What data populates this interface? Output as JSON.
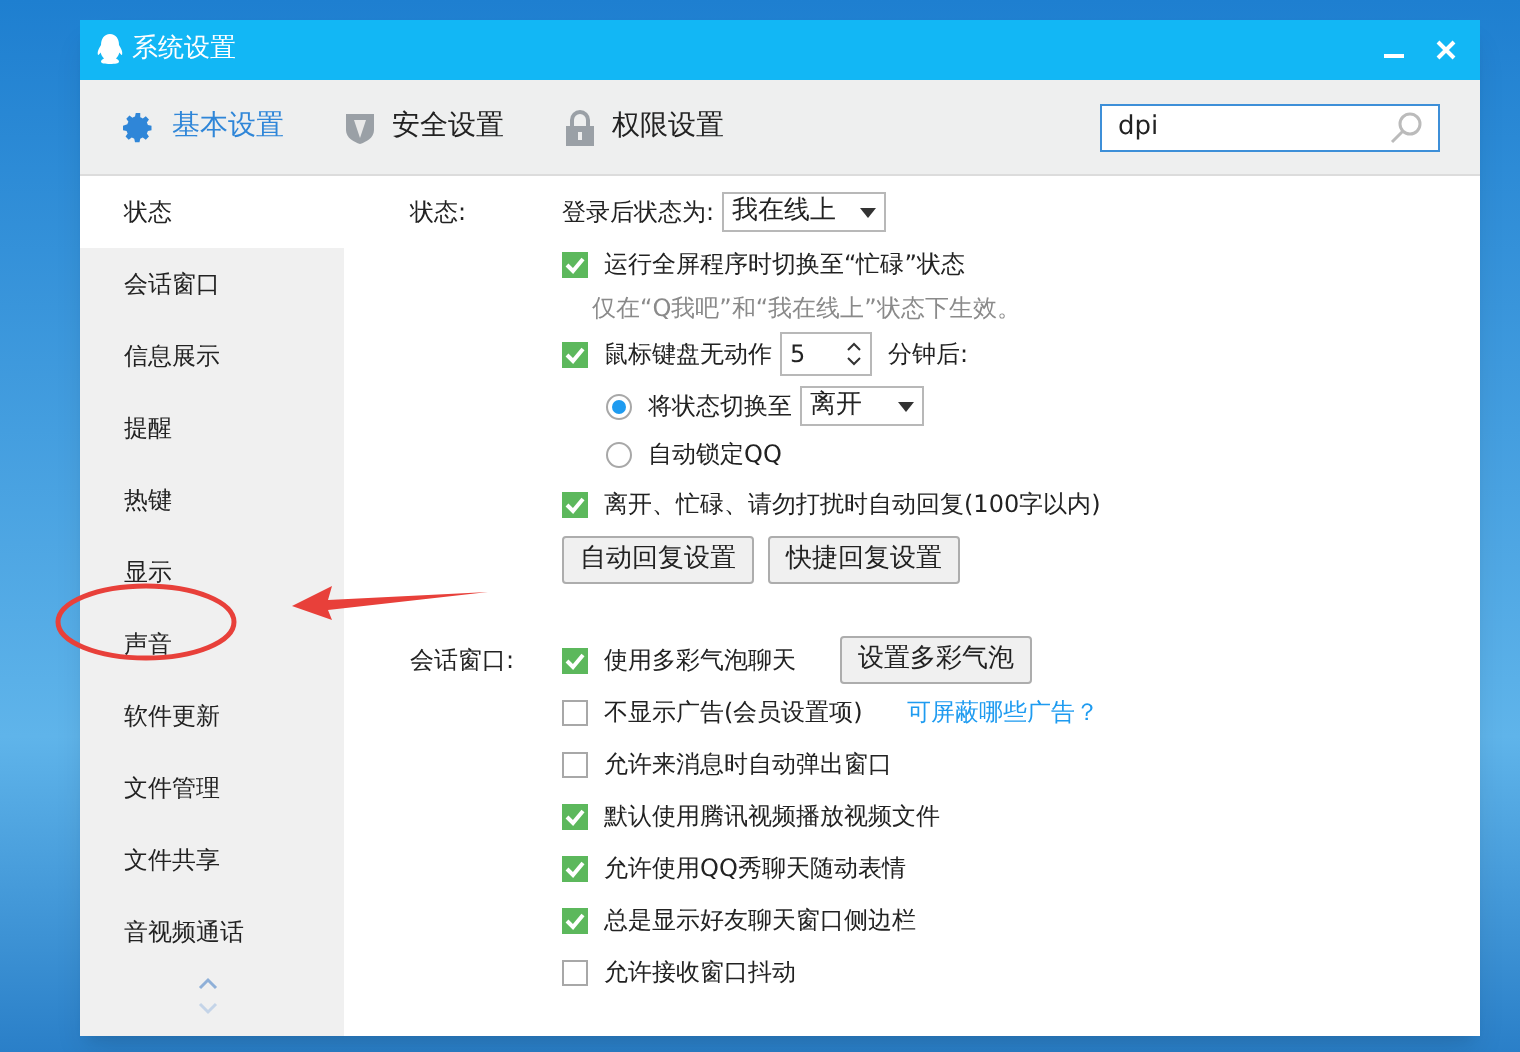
{
  "window": {
    "title": "系统设置"
  },
  "tabs": [
    {
      "label": "基本设置",
      "kind": "gear",
      "selected": true
    },
    {
      "label": "安全设置",
      "kind": "shield",
      "selected": false
    },
    {
      "label": "权限设置",
      "kind": "lock",
      "selected": false
    }
  ],
  "search": {
    "value": "dpi"
  },
  "sidebar": {
    "items": [
      {
        "label": "状态",
        "selected": true
      },
      {
        "label": "会话窗口",
        "selected": false
      },
      {
        "label": "信息展示",
        "selected": false
      },
      {
        "label": "提醒",
        "selected": false
      },
      {
        "label": "热键",
        "selected": false
      },
      {
        "label": "显示",
        "selected": false
      },
      {
        "label": "声音",
        "selected": false
      },
      {
        "label": "软件更新",
        "selected": false
      },
      {
        "label": "文件管理",
        "selected": false
      },
      {
        "label": "文件共享",
        "selected": false
      },
      {
        "label": "音视频通话",
        "selected": false
      }
    ]
  },
  "sections": [
    {
      "label": "状态:",
      "rows": [
        {
          "kind": "select",
          "label": "登录后状态为:",
          "value": "我在线上"
        },
        {
          "kind": "checkbox",
          "label": "运行全屏程序时切换至“忙碌”状态",
          "checked": true
        },
        {
          "kind": "hint",
          "label": "仅在“Q我吧”和“我在线上”状态下生效。"
        },
        {
          "kind": "spinner",
          "label": "鼠标键盘无动作",
          "value": "5",
          "suffix": "分钟后:",
          "checked": true
        },
        {
          "kind": "radio",
          "label": "将状态切换至",
          "value": "离开",
          "checked": true
        },
        {
          "kind": "radio",
          "label": "自动锁定QQ",
          "checked": false
        },
        {
          "kind": "checkbox",
          "label": "离开、忙碌、请勿打扰时自动回复(100字以内)",
          "checked": true
        },
        {
          "kind": "buttons",
          "buttons": [
            "自动回复设置",
            "快捷回复设置"
          ]
        }
      ]
    },
    {
      "label": "会话窗口:",
      "rows": [
        {
          "kind": "checkbox",
          "label": "使用多彩气泡聊天",
          "checked": true,
          "button": "设置多彩气泡"
        },
        {
          "kind": "checkbox",
          "label": "不显示广告(会员设置项)",
          "checked": false,
          "link": "可屏蔽哪些广告？"
        },
        {
          "kind": "checkbox",
          "label": "允许来消息时自动弹出窗口",
          "checked": false
        },
        {
          "kind": "checkbox",
          "label": "默认使用腾讯视频播放视频文件",
          "checked": true
        },
        {
          "kind": "checkbox",
          "label": "允许使用QQ秀聊天随动表情",
          "checked": true
        },
        {
          "kind": "checkbox",
          "label": "总是显示好友聊天窗口侧边栏",
          "checked": true
        },
        {
          "kind": "checkbox",
          "label": "允许接收窗口抖动",
          "checked": false
        }
      ]
    }
  ]
}
